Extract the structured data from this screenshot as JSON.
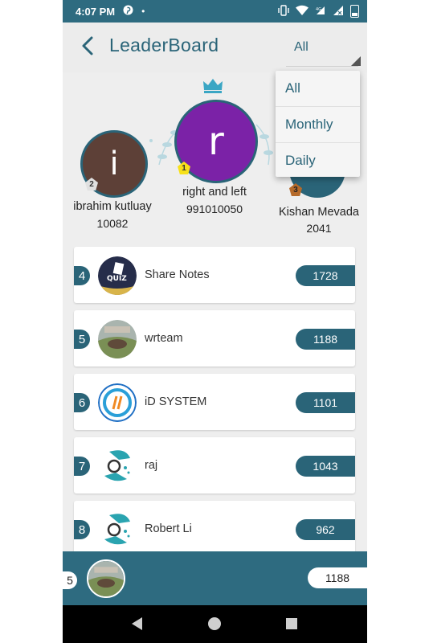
{
  "status": {
    "time": "4:07 PM"
  },
  "header": {
    "title": "LeaderBoard",
    "filter_value": "All"
  },
  "filter_menu": {
    "options": [
      "All",
      "Monthly",
      "Daily"
    ]
  },
  "podium": {
    "first": {
      "initial": "r",
      "name": "right and left",
      "score": "991010050",
      "rank": "1"
    },
    "second": {
      "initial": "i",
      "name": "ibrahim kutluay",
      "score": "10082",
      "rank": "2"
    },
    "third": {
      "initial": "",
      "name": "Kishan Mevada",
      "score": "2041",
      "rank": "3"
    }
  },
  "rows": [
    {
      "rank": "4",
      "name": "Share Notes",
      "score": "1728"
    },
    {
      "rank": "5",
      "name": "wrteam",
      "score": "1188"
    },
    {
      "rank": "6",
      "name": "iD SYSTEM",
      "score": "1101"
    },
    {
      "rank": "7",
      "name": "raj",
      "score": "1043"
    },
    {
      "rank": "8",
      "name": "Robert Li",
      "score": "962"
    }
  ],
  "current_user": {
    "rank": "5",
    "score": "1188"
  },
  "avatar_text": {
    "quiz": "QUIZ"
  },
  "colors": {
    "primary": "#2a6478",
    "accent_gold": "#f7e11a",
    "purple": "#7b22a7"
  }
}
